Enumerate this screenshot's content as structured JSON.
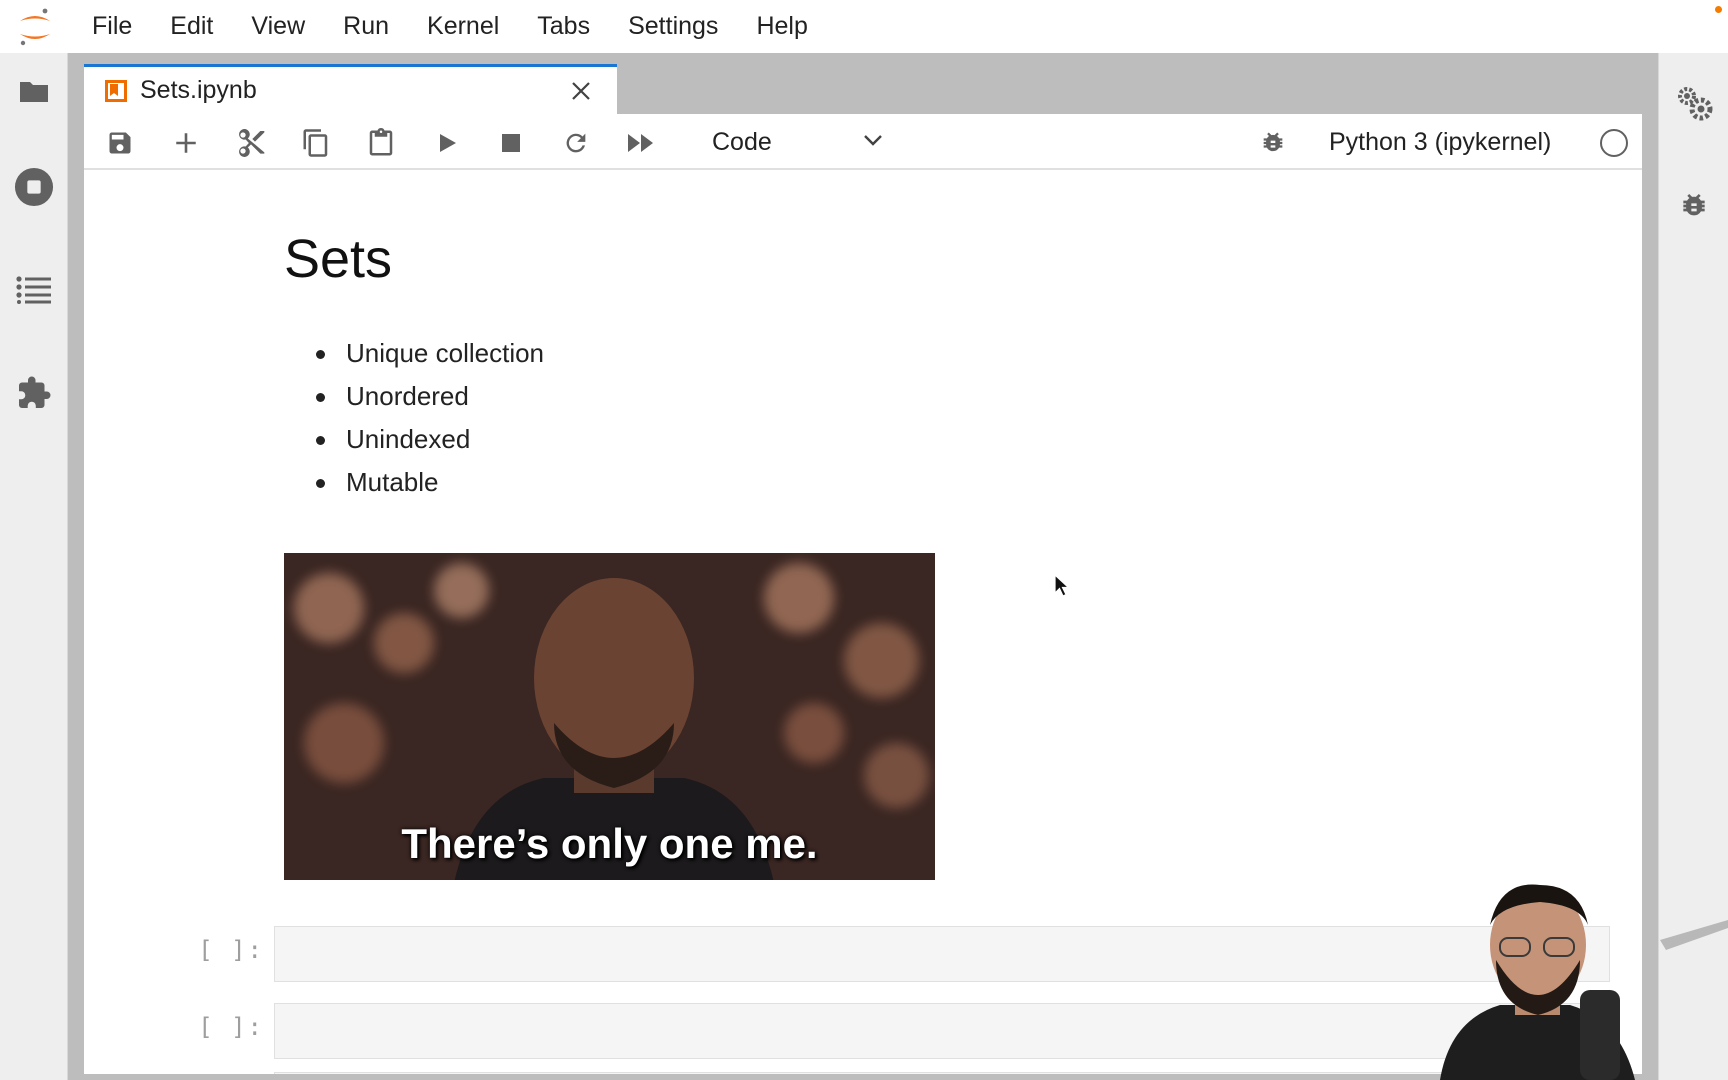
{
  "menubar": {
    "items": [
      "File",
      "Edit",
      "View",
      "Run",
      "Kernel",
      "Tabs",
      "Settings",
      "Help"
    ]
  },
  "left_sidebar": {
    "icons": [
      "folder-icon",
      "running-kernels-icon",
      "table-of-contents-icon",
      "extension-manager-icon"
    ]
  },
  "right_sidebar": {
    "icons": [
      "property-inspector-icon",
      "debugger-icon"
    ]
  },
  "tab": {
    "title": "Sets.ipynb",
    "icon": "notebook-icon"
  },
  "toolbar": {
    "buttons": [
      "save-icon",
      "add-cell-icon",
      "cut-icon",
      "copy-icon",
      "paste-icon",
      "run-icon",
      "stop-icon",
      "restart-icon",
      "run-all-icon"
    ],
    "cell_type": "Code",
    "kernel_name": "Python 3 (ipykernel)",
    "kernel_status": "idle"
  },
  "notebook": {
    "heading": "Sets",
    "bullets": [
      "Unique collection",
      "Unordered",
      "Unindexed",
      "Mutable"
    ],
    "gif_caption": "There’s only one me.",
    "code_cells": [
      {
        "prompt": "[ ]:",
        "source": ""
      },
      {
        "prompt": "[ ]:",
        "source": ""
      }
    ]
  },
  "colors": {
    "accent": "#1976d2",
    "jupyter_orange": "#f37726",
    "sidebar_bg": "#eeeeee",
    "dock_bg": "#bdbdbd"
  }
}
